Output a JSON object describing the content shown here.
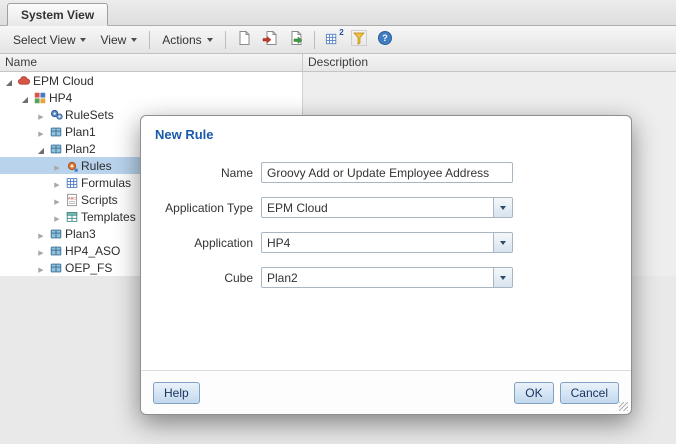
{
  "tab": {
    "label": "System View"
  },
  "toolbar": {
    "menus": [
      {
        "label": "Select View"
      },
      {
        "label": "View"
      },
      {
        "label": "Actions"
      }
    ],
    "icon_buttons": [
      "new-document-icon",
      "import-icon",
      "deploy-icon",
      "validate-icon",
      "filter-icon",
      "help-icon"
    ],
    "validate_badge": "2"
  },
  "columns": {
    "name": "Name",
    "description": "Description"
  },
  "tree": {
    "nodes": [
      {
        "label": "EPM Cloud",
        "level": 0,
        "state": "expanded",
        "icon": "cloud-icon",
        "selected": false
      },
      {
        "label": "HP4",
        "level": 1,
        "state": "expanded",
        "icon": "application-icon",
        "selected": false
      },
      {
        "label": "RuleSets",
        "level": 2,
        "state": "collapsed",
        "icon": "rulesets-icon",
        "selected": false
      },
      {
        "label": "Plan1",
        "level": 2,
        "state": "collapsed",
        "icon": "cube-icon",
        "selected": false
      },
      {
        "label": "Plan2",
        "level": 2,
        "state": "expanded",
        "icon": "cube-icon",
        "selected": false
      },
      {
        "label": "Rules",
        "level": 3,
        "state": "collapsed",
        "icon": "rules-icon",
        "selected": true
      },
      {
        "label": "Formulas",
        "level": 3,
        "state": "collapsed",
        "icon": "formulas-icon",
        "selected": false
      },
      {
        "label": "Scripts",
        "level": 3,
        "state": "collapsed",
        "icon": "scripts-icon",
        "selected": false
      },
      {
        "label": "Templates",
        "level": 3,
        "state": "collapsed",
        "icon": "templates-icon",
        "selected": false
      },
      {
        "label": "Plan3",
        "level": 2,
        "state": "collapsed",
        "icon": "cube-icon",
        "selected": false
      },
      {
        "label": "HP4_ASO",
        "level": 2,
        "state": "collapsed",
        "icon": "cube-icon",
        "selected": false
      },
      {
        "label": "OEP_FS",
        "level": 2,
        "state": "collapsed",
        "icon": "cube-icon",
        "selected": false
      }
    ]
  },
  "dialog": {
    "title": "New Rule",
    "fields": [
      {
        "label": "Name",
        "type": "text",
        "value": "Groovy Add or Update Employee Address"
      },
      {
        "label": "Application Type",
        "type": "select",
        "value": "EPM Cloud"
      },
      {
        "label": "Application",
        "type": "select",
        "value": "HP4"
      },
      {
        "label": "Cube",
        "type": "select",
        "value": "Plan2"
      }
    ],
    "buttons": {
      "help": "Help",
      "ok": "OK",
      "cancel": "Cancel"
    }
  },
  "colors": {
    "selection_highlight": "#b9d3ec",
    "dialog_title": "#1a5aa8",
    "button_face": "#c2d8ee",
    "button_border": "#7fa1c4"
  }
}
